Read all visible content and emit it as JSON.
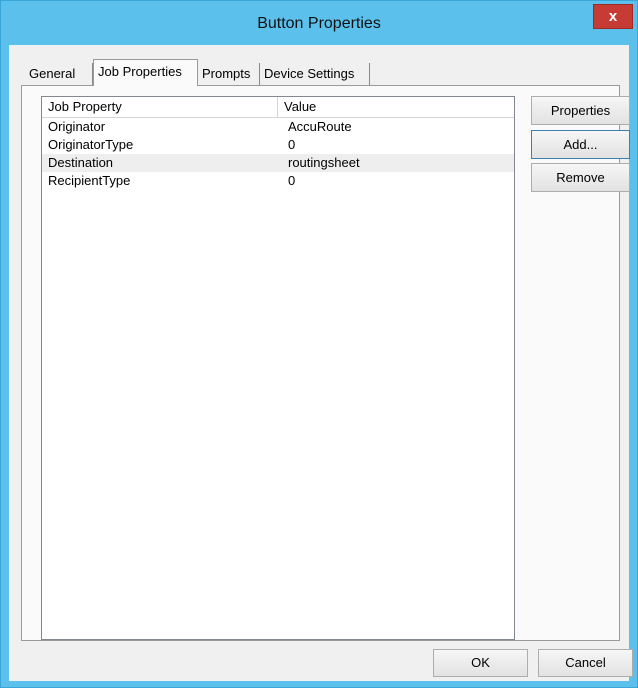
{
  "window": {
    "title": "Button Properties",
    "close_label": "x"
  },
  "tabs": [
    {
      "label": "General"
    },
    {
      "label": "Job Properties"
    },
    {
      "label": "Prompts"
    },
    {
      "label": "Device Settings"
    }
  ],
  "active_tab": "Job Properties",
  "list": {
    "columns": [
      "Job Property",
      "Value"
    ],
    "rows": [
      {
        "property": "Originator",
        "value": "AccuRoute"
      },
      {
        "property": "OriginatorType",
        "value": "0"
      },
      {
        "property": "Destination",
        "value": "routingsheet"
      },
      {
        "property": "RecipientType",
        "value": "0"
      }
    ],
    "selected_row": "Destination"
  },
  "side_buttons": {
    "properties": "Properties",
    "add": "Add...",
    "remove": "Remove"
  },
  "footer": {
    "ok": "OK",
    "cancel": "Cancel"
  },
  "colors": {
    "titlebar": "#5cc0ec",
    "close": "#c63b33"
  }
}
